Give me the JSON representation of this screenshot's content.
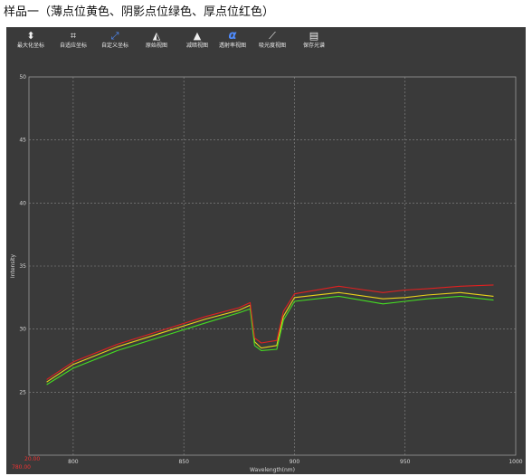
{
  "caption": "样品一（薄点位黄色、阴影点位绿色、厚点位红色）",
  "toolbar": {
    "items": [
      {
        "label": "最大化坐标",
        "icon": "maximize-icon"
      },
      {
        "label": "自适应坐标",
        "icon": "auto-fit-icon"
      },
      {
        "label": "自定义坐标",
        "icon": "custom-axis-icon"
      },
      {
        "label": "原始视图",
        "icon": "raw-view-icon"
      },
      {
        "label": "减暗视图",
        "icon": "dark-subtract-icon"
      },
      {
        "label": "透射率视图",
        "icon": "alpha-icon",
        "glyph": "α"
      },
      {
        "label": "吸光度视图",
        "icon": "absorbance-icon"
      },
      {
        "label": "保存光谱",
        "icon": "save-spectrum-icon"
      }
    ]
  },
  "chart_data": {
    "type": "line",
    "title": "",
    "xlabel": "Wavelength(nm)",
    "ylabel": "Intensity",
    "xlim": [
      780,
      1000
    ],
    "ylim": [
      20,
      50
    ],
    "xticks": [
      800,
      850,
      900,
      950,
      1000
    ],
    "yticks": [
      20,
      25,
      30,
      35,
      40,
      45,
      50
    ],
    "corner_labels": {
      "x_start": "780.00",
      "y_start": "20.00"
    },
    "grid": true,
    "background": "#3a3a3a",
    "series": [
      {
        "color": "#e8d21a",
        "x": [
          788,
          800,
          820,
          840,
          860,
          875,
          880,
          882,
          885,
          892,
          895,
          900,
          920,
          940,
          950,
          960,
          975,
          990
        ],
        "y": [
          25.8,
          27.2,
          28.6,
          29.7,
          30.8,
          31.5,
          31.9,
          29.0,
          28.5,
          28.7,
          31.0,
          32.5,
          32.9,
          32.4,
          32.5,
          32.7,
          32.9,
          32.6
        ]
      },
      {
        "color": "#44dd22",
        "x": [
          788,
          800,
          820,
          840,
          860,
          875,
          880,
          882,
          885,
          892,
          895,
          900,
          920,
          940,
          950,
          960,
          975,
          990
        ],
        "y": [
          25.6,
          26.9,
          28.3,
          29.4,
          30.5,
          31.3,
          31.6,
          28.7,
          28.3,
          28.4,
          30.7,
          32.2,
          32.6,
          32.0,
          32.2,
          32.4,
          32.6,
          32.3
        ]
      },
      {
        "color": "#e02020",
        "x": [
          788,
          800,
          820,
          840,
          860,
          875,
          880,
          882,
          885,
          892,
          895,
          900,
          920,
          940,
          950,
          960,
          975,
          990
        ],
        "y": [
          26.0,
          27.4,
          28.8,
          29.9,
          31.0,
          31.7,
          32.1,
          29.3,
          28.9,
          29.1,
          31.4,
          32.8,
          33.4,
          32.9,
          33.1,
          33.2,
          33.4,
          33.5
        ]
      }
    ]
  }
}
